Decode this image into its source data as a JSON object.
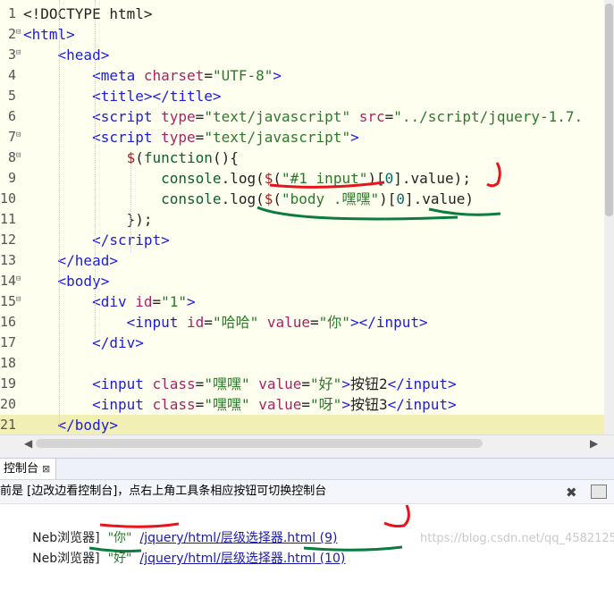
{
  "editor": {
    "lines": [
      {
        "num": "1",
        "fold": "",
        "html": "<span class='p'>&lt;!DOCTYPE html&gt;</span>"
      },
      {
        "num": "2",
        "fold": "⊟",
        "html": "<span class='t'>&lt;html&gt;</span>"
      },
      {
        "num": "3",
        "fold": "⊟",
        "html": "    <span class='t'>&lt;head&gt;</span>"
      },
      {
        "num": "4",
        "fold": "",
        "html": "        <span class='t'>&lt;meta</span> <span class='a'>charset</span><span class='p'>=</span><span class='s'>\"UTF-8\"</span><span class='t'>&gt;</span>"
      },
      {
        "num": "5",
        "fold": "",
        "html": "        <span class='t'>&lt;title&gt;&lt;/title&gt;</span>"
      },
      {
        "num": "6",
        "fold": "",
        "html": "        <span class='t'>&lt;script</span> <span class='a'>type</span><span class='p'>=</span><span class='s'>\"text/javascript\"</span> <span class='a'>src</span><span class='p'>=</span><span class='s'>\"../script/jquery-1.7.</span>"
      },
      {
        "num": "7",
        "fold": "⊟",
        "html": "        <span class='t'>&lt;script</span> <span class='a'>type</span><span class='p'>=</span><span class='s'>\"text/javascript\"</span><span class='t'>&gt;</span>"
      },
      {
        "num": "8",
        "fold": "⊟",
        "html": "            <span class='k'>$</span><span class='p'>(</span><span class='f'>function</span><span class='p'>(){</span>"
      },
      {
        "num": "9",
        "fold": "",
        "html": "                <span class='f'>console</span><span class='p'>.log(</span><span class='k'>$</span><span class='p'>(</span><span class='s'>\"#1 input\"</span><span class='p'>)[</span><span class='n'>0</span><span class='p'>].value);</span>"
      },
      {
        "num": "10",
        "fold": "",
        "html": "                <span class='f'>console</span><span class='p'>.log(</span><span class='k'>$</span><span class='p'>(</span><span class='s'>\"body .嘿嘿\"</span><span class='p'>)[</span><span class='n'>0</span><span class='p'>].value)</span>"
      },
      {
        "num": "11",
        "fold": "",
        "html": "            <span class='p'>});</span>"
      },
      {
        "num": "12",
        "fold": "",
        "html": "        <span class='t'>&lt;/script&gt;</span>"
      },
      {
        "num": "13",
        "fold": "",
        "html": "    <span class='t'>&lt;/head&gt;</span>"
      },
      {
        "num": "14",
        "fold": "⊟",
        "html": "    <span class='t'>&lt;body&gt;</span>"
      },
      {
        "num": "15",
        "fold": "⊟",
        "html": "        <span class='t'>&lt;div</span> <span class='a'>id</span><span class='p'>=</span><span class='s'>\"1\"</span><span class='t'>&gt;</span>"
      },
      {
        "num": "16",
        "fold": "",
        "html": "            <span class='t'>&lt;input</span> <span class='a'>id</span><span class='p'>=</span><span class='s'>\"哈哈\"</span> <span class='a'>value</span><span class='p'>=</span><span class='s'>\"你\"</span><span class='t'>&gt;&lt;/input&gt;</span>"
      },
      {
        "num": "17",
        "fold": "",
        "html": "        <span class='t'>&lt;/div&gt;</span>"
      },
      {
        "num": "18",
        "fold": "",
        "html": ""
      },
      {
        "num": "19",
        "fold": "",
        "html": "        <span class='t'>&lt;input</span> <span class='a'>class</span><span class='p'>=</span><span class='s'>\"嘿嘿\"</span> <span class='a'>value</span><span class='p'>=</span><span class='s'>\"好\"</span><span class='t'>&gt;</span><span class='p'>按钮2</span><span class='t'>&lt;/input&gt;</span>"
      },
      {
        "num": "20",
        "fold": "",
        "html": "        <span class='t'>&lt;input</span> <span class='a'>class</span><span class='p'>=</span><span class='s'>\"嘿嘿\"</span> <span class='a'>value</span><span class='p'>=</span><span class='s'>\"呀\"</span><span class='t'>&gt;</span><span class='p'>按钮3</span><span class='t'>&lt;/input&gt;</span>"
      },
      {
        "num": "21",
        "fold": "",
        "html": "    <span class='t'>&lt;/body&gt;</span>"
      }
    ]
  },
  "console": {
    "tab_label": "控制台",
    "tab_close": "⊠",
    "info_text": "前是 [边改边看控制台]，点右上角工具条相应按钮可切换控制台",
    "clear_icon": "✖",
    "output": [
      {
        "prefix": "Neb浏览器]",
        "value": "\"你\"",
        "link": "/jquery/html/层级选择器.html (9)"
      },
      {
        "prefix": "Neb浏览器]",
        "value": "\"好\"",
        "link": "/jquery/html/层级选择器.html (10)"
      }
    ]
  },
  "watermark": "https://blog.csdn.net/qq_45821251",
  "colors": {
    "editor_bg": "#fffff0",
    "current_line": "#f1efb3",
    "tag": "#1b1be0",
    "string": "#2a7a2a",
    "red_ink": "#e8131b",
    "green_ink": "#0a7d3e"
  }
}
